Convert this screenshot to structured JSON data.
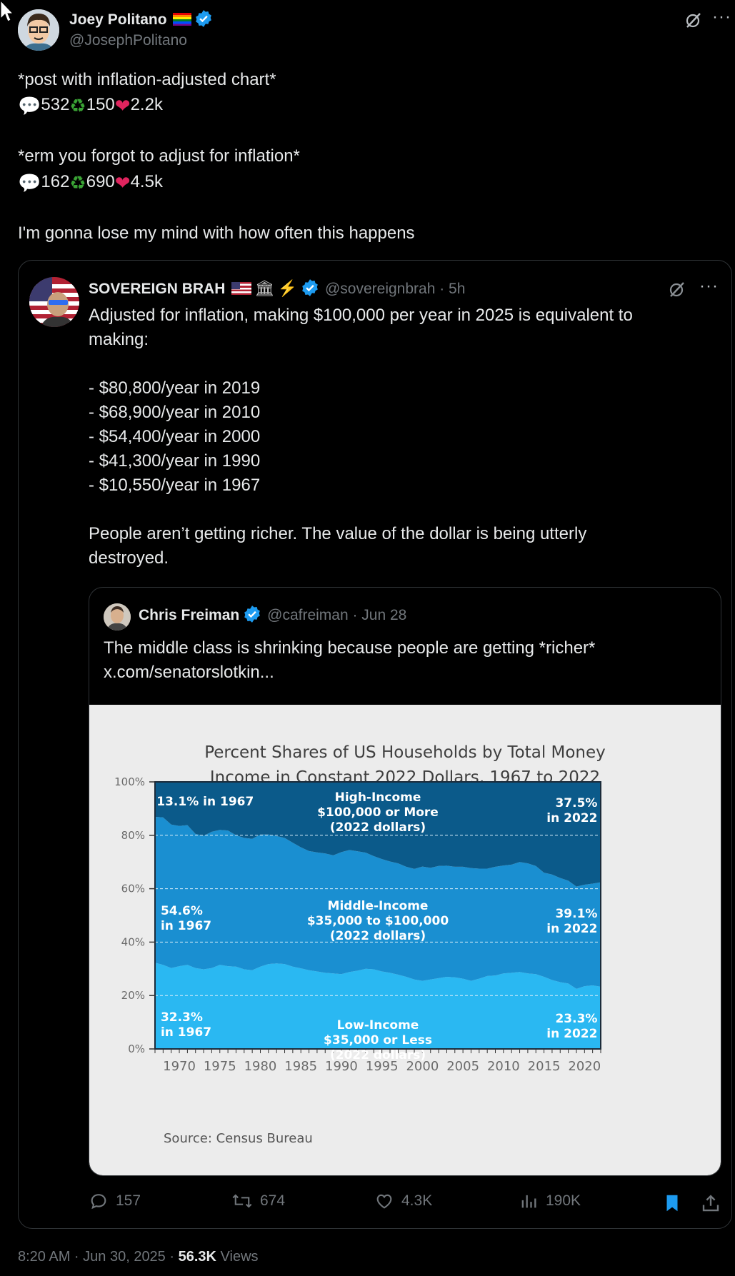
{
  "main_post": {
    "name": "Joey Politano",
    "handle": "@JosephPolitano",
    "line1": "*post with inflation-adjusted chart*",
    "stats1": {
      "replies": "532",
      "reposts": "150",
      "likes": "2.2k"
    },
    "line2": "*erm you forgot to adjust for inflation*",
    "stats2": {
      "replies": "162",
      "reposts": "690",
      "likes": "4.5k"
    },
    "line3": "I'm gonna lose my mind with how often this happens",
    "timestamp": "8:20 AM · Jun 30, 2025 · ",
    "views_count": "56.3K",
    "views_label": " Views"
  },
  "quoted_post": {
    "name": "SOVEREIGN BRAH",
    "handle_meta": "@sovereignbrah · 5h",
    "text_lines": [
      "Adjusted for inflation, making $100,000 per year in 2025 is equivalent to",
      "making:",
      "",
      "- $80,800/year in 2019",
      "- $68,900/year in 2010",
      "- $54,400/year in 2000",
      "- $41,300/year in 1990",
      "- $10,550/year in 1967",
      "",
      "People aren’t getting richer. The value of the dollar is being utterly",
      "destroyed."
    ],
    "actions": {
      "replies": "157",
      "reposts": "674",
      "likes": "4.3K",
      "views": "190K"
    }
  },
  "nested_post": {
    "name": "Chris Freiman",
    "handle_meta": "@cafreiman · Jun 28",
    "text_line1": "The middle class is shrinking because people are getting *richer*",
    "text_line2": "x.com/senatorslotkin..."
  },
  "chart_data": {
    "type": "area",
    "title_lines": [
      "Percent Shares of US Households by Total Money",
      "Income in Constant 2022 Dollars, 1967 to 2022"
    ],
    "source": "Source: Census Bureau",
    "y_ticks": [
      "100%",
      "80%",
      "60%",
      "40%",
      "20%",
      "0%"
    ],
    "x_ticks": [
      "1970",
      "1975",
      "1980",
      "1985",
      "1990",
      "1995",
      "2000",
      "2005",
      "2010",
      "2015",
      "2020"
    ],
    "ylim": [
      0,
      100
    ],
    "xlim": [
      1967,
      2022
    ],
    "x": [
      1967,
      1968,
      1969,
      1970,
      1971,
      1972,
      1973,
      1974,
      1975,
      1976,
      1977,
      1978,
      1979,
      1980,
      1981,
      1982,
      1983,
      1984,
      1985,
      1986,
      1987,
      1988,
      1989,
      1990,
      1991,
      1992,
      1993,
      1994,
      1995,
      1996,
      1997,
      1998,
      1999,
      2000,
      2001,
      2002,
      2003,
      2004,
      2005,
      2006,
      2007,
      2008,
      2009,
      2010,
      2011,
      2012,
      2013,
      2014,
      2015,
      2016,
      2017,
      2018,
      2019,
      2020,
      2021,
      2022
    ],
    "series": [
      {
        "name": "Low-Income",
        "color": "#2ab8f2",
        "values": [
          32.3,
          31.5,
          30.3,
          31.0,
          31.5,
          30.3,
          29.8,
          30.3,
          31.5,
          31.0,
          30.8,
          29.8,
          29.5,
          30.8,
          31.8,
          32.0,
          31.8,
          30.8,
          30.2,
          29.5,
          29.0,
          28.5,
          28.3,
          28.0,
          28.8,
          29.3,
          30.0,
          29.8,
          29.0,
          28.5,
          27.8,
          27.0,
          26.0,
          25.5,
          26.0,
          26.5,
          27.0,
          26.8,
          26.3,
          25.5,
          26.3,
          27.3,
          27.5,
          28.3,
          28.5,
          28.8,
          28.3,
          28.0,
          27.0,
          25.8,
          25.0,
          24.5,
          22.5,
          23.5,
          23.8,
          23.3
        ]
      },
      {
        "name": "Middle-Income",
        "color": "#1a8fd1",
        "values": [
          54.6,
          55.2,
          53.7,
          52.5,
          52.3,
          50.2,
          50.0,
          51.0,
          50.5,
          50.8,
          49.2,
          49.2,
          49.2,
          49.5,
          48.5,
          47.7,
          47.2,
          46.4,
          45.3,
          44.6,
          44.6,
          44.7,
          44.2,
          45.7,
          45.7,
          44.7,
          43.5,
          42.4,
          42.1,
          41.7,
          41.7,
          41.2,
          41.4,
          42.8,
          41.8,
          42.0,
          41.6,
          41.4,
          41.9,
          42.2,
          41.2,
          40.2,
          40.7,
          40.4,
          40.5,
          41.2,
          41.2,
          40.5,
          39.0,
          39.5,
          39.0,
          38.5,
          38.3,
          38.0,
          38.1,
          39.1
        ]
      },
      {
        "name": "High-Income",
        "color": "#0b5a8a",
        "values": [
          13.1,
          13.3,
          16.0,
          16.5,
          16.2,
          19.5,
          20.2,
          18.7,
          18.0,
          18.2,
          20.0,
          21.0,
          21.3,
          19.7,
          19.7,
          20.3,
          21.0,
          22.8,
          24.5,
          25.9,
          26.4,
          26.8,
          27.5,
          26.3,
          25.5,
          26.0,
          26.5,
          27.8,
          28.9,
          29.8,
          30.5,
          31.8,
          32.6,
          31.7,
          32.2,
          31.5,
          31.4,
          31.8,
          31.8,
          32.3,
          32.5,
          32.5,
          31.8,
          31.3,
          31.0,
          30.0,
          30.5,
          31.5,
          34.0,
          34.7,
          36.0,
          37.0,
          39.2,
          38.5,
          38.1,
          37.6
        ]
      }
    ],
    "annotations": {
      "high_label": [
        "High-Income",
        "$100,000 or More",
        "(2022 dollars)"
      ],
      "mid_label": [
        "Middle-Income",
        "$35,000 to $100,000",
        "(2022 dollars)"
      ],
      "low_label": [
        "Low-Income",
        "$35,000 or Less",
        "(2022 dollars)"
      ],
      "high_start": [
        "13.1% in 1967"
      ],
      "high_end": [
        "37.5%",
        "in 2022"
      ],
      "mid_start": [
        "54.6%",
        "in 1967"
      ],
      "mid_end": [
        "39.1%",
        "in 2022"
      ],
      "low_start": [
        "32.3%",
        "in 1967"
      ],
      "low_end": [
        "23.3%",
        "in 2022"
      ]
    }
  }
}
